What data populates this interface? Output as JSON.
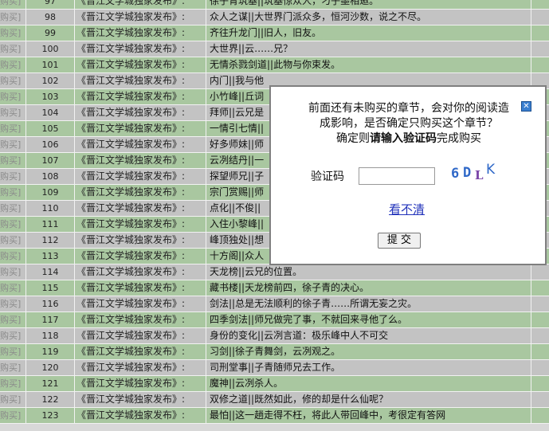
{
  "chapters": [
    {
      "buy": "购买]",
      "num": "97",
      "publisher": "《晋江文学城独家发布》:",
      "title": "徐子青筑基||筑基惊众人，刁子墨相邀。"
    },
    {
      "buy": "购买]",
      "num": "98",
      "publisher": "《晋江文学城独家发布》:",
      "title": "众人之谋||大世界门派众多，恒河沙数，说之不尽。"
    },
    {
      "buy": "购买]",
      "num": "99",
      "publisher": "《晋江文学城独家发布》:",
      "title": "齐往升龙门||旧人，旧友。"
    },
    {
      "buy": "购买]",
      "num": "100",
      "publisher": "《晋江文学城独家发布》:",
      "title": "大世界||云……兄？"
    },
    {
      "buy": "购买]",
      "num": "101",
      "publisher": "《晋江文学城独家发布》:",
      "title": "无情杀戮剑道||此物与你束发。"
    },
    {
      "buy": "购买]",
      "num": "102",
      "publisher": "《晋江文学城独家发布》:",
      "title": "内门||我与他"
    },
    {
      "buy": "购买]",
      "num": "103",
      "publisher": "《晋江文学城独家发布》:",
      "title": "小竹峰||丘词"
    },
    {
      "buy": "购买]",
      "num": "104",
      "publisher": "《晋江文学城独家发布》:",
      "title": "拜师||云兄是"
    },
    {
      "buy": "购买]",
      "num": "105",
      "publisher": "《晋江文学城独家发布》:",
      "title": "一情引七情||"
    },
    {
      "buy": "购买]",
      "num": "106",
      "publisher": "《晋江文学城独家发布》:",
      "title": "好多师妹||师"
    },
    {
      "buy": "购买]",
      "num": "107",
      "publisher": "《晋江文学城独家发布》:",
      "title": "云冽结丹||一"
    },
    {
      "buy": "购买]",
      "num": "108",
      "publisher": "《晋江文学城独家发布》:",
      "title": "探望师兄||子"
    },
    {
      "buy": "购买]",
      "num": "109",
      "publisher": "《晋江文学城独家发布》:",
      "title": "宗门赏赐||师"
    },
    {
      "buy": "购买]",
      "num": "110",
      "publisher": "《晋江文学城独家发布》:",
      "title": "点化||不俊||"
    },
    {
      "buy": "购买]",
      "num": "111",
      "publisher": "《晋江文学城独家发布》:",
      "title": "入住小黎峰||"
    },
    {
      "buy": "购买]",
      "num": "112",
      "publisher": "《晋江文学城独家发布》:",
      "title": "峰顶独处||想"
    },
    {
      "buy": "购买]",
      "num": "113",
      "publisher": "《晋江文学城独家发布》:",
      "title": "十方阁||众人"
    },
    {
      "buy": "购买]",
      "num": "114",
      "publisher": "《晋江文学城独家发布》:",
      "title": "天龙榜||云兄的位置。"
    },
    {
      "buy": "购买]",
      "num": "115",
      "publisher": "《晋江文学城独家发布》:",
      "title": "藏书楼||天龙榜前四，徐子青的决心。"
    },
    {
      "buy": "购买]",
      "num": "116",
      "publisher": "《晋江文学城独家发布》:",
      "title": "剑法||总是无法顺利的徐子青……所谓无妄之灾。"
    },
    {
      "buy": "购买]",
      "num": "117",
      "publisher": "《晋江文学城独家发布》:",
      "title": "四季剑法||师兄做完了事，不就回来寻他了么。"
    },
    {
      "buy": "购买]",
      "num": "118",
      "publisher": "《晋江文学城独家发布》:",
      "title": "身份的变化||云冽言道：极乐峰中人不可交"
    },
    {
      "buy": "购买]",
      "num": "119",
      "publisher": "《晋江文学城独家发布》:",
      "title": "习剑||徐子青舞剑，云冽观之。"
    },
    {
      "buy": "购买]",
      "num": "120",
      "publisher": "《晋江文学城独家发布》:",
      "title": "司刑堂事||子青随师兄去工作。"
    },
    {
      "buy": "购买]",
      "num": "121",
      "publisher": "《晋江文学城独家发布》:",
      "title": "魔神||云冽杀人。"
    },
    {
      "buy": "购买]",
      "num": "122",
      "publisher": "《晋江文学城独家发布》:",
      "title": "双修之道||既然如此，修的却是什么仙呢？"
    },
    {
      "buy": "购买]",
      "num": "123",
      "publisher": "《晋江文学城独家发布》:",
      "title": "最怕||这一趟走得不枉，将此人带回峰中，考很定有答网"
    }
  ],
  "dialog": {
    "message_line1": "前面还有未购买的章节，会对你的阅读造",
    "message_line2": "成影响，是否确定只购买这个章节？",
    "message_line3_prefix": "确定则",
    "message_line3_bold": "请输入验证码",
    "message_line3_suffix": "完成购买",
    "captcha_label": "验证码",
    "captcha_value": "",
    "captcha_text": "6DLK",
    "refresh_link": "看不清",
    "submit_label": "提 交",
    "close_icon": "close-icon"
  },
  "colors": {
    "row_green": "#a9c7a0",
    "row_grey": "#c3c3c3",
    "link": "#2233bb"
  }
}
